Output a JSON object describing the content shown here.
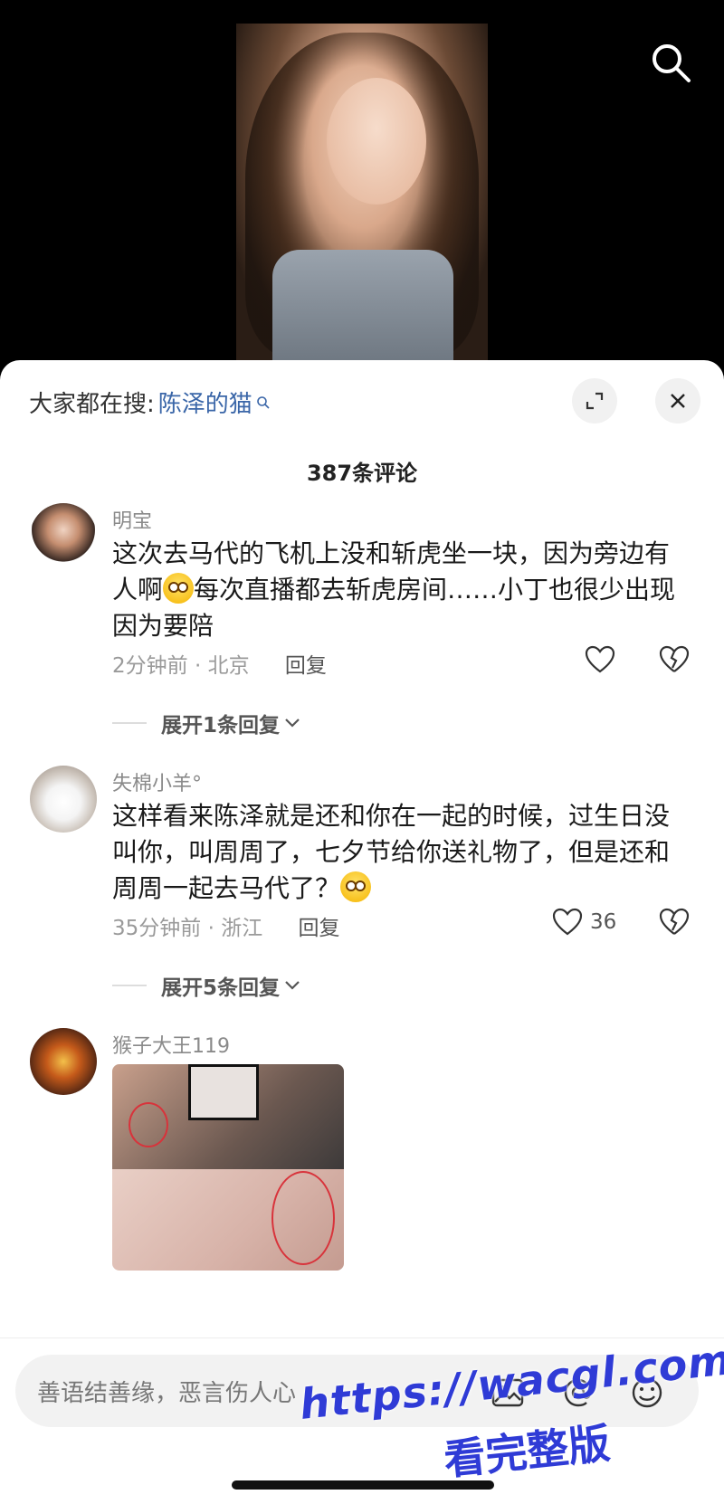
{
  "trending": {
    "prefix": "大家都在搜:",
    "keyword": "陈泽的猫"
  },
  "comments_header": {
    "count_label": "387条评论"
  },
  "comments": [
    {
      "username": "明宝",
      "text_part1": "这次去马代的飞机上没和斩虎坐一块，因为旁边有人啊",
      "emoji": "face-emoji",
      "text_part2": "每次直播都去斩虎房间……小丁也很少出现因为要陪",
      "time_location": "2分钟前 · 北京",
      "reply_label": "回复",
      "likes": "",
      "expand_label": "展开1条回复"
    },
    {
      "username": "失棉小羊°",
      "text_part1": "这样看来陈泽就是还和你在一起的时候，过生日没叫你，叫周周了，七夕节给你送礼物了，但是还和周周一起去马代了？",
      "emoji": "shocked-emoji",
      "text_part2": "",
      "time_location": "35分钟前 · 浙江",
      "reply_label": "回复",
      "likes": "36",
      "expand_label": "展开5条回复"
    },
    {
      "username": "猴子大王119"
    }
  ],
  "input": {
    "placeholder": "善语结善缘，恶言伤人心"
  },
  "watermark": {
    "line1": "https://wacgl.com",
    "line2": "看完整版"
  },
  "colors": {
    "link": "#3a66a8",
    "watermark": "#2f3bd6"
  }
}
